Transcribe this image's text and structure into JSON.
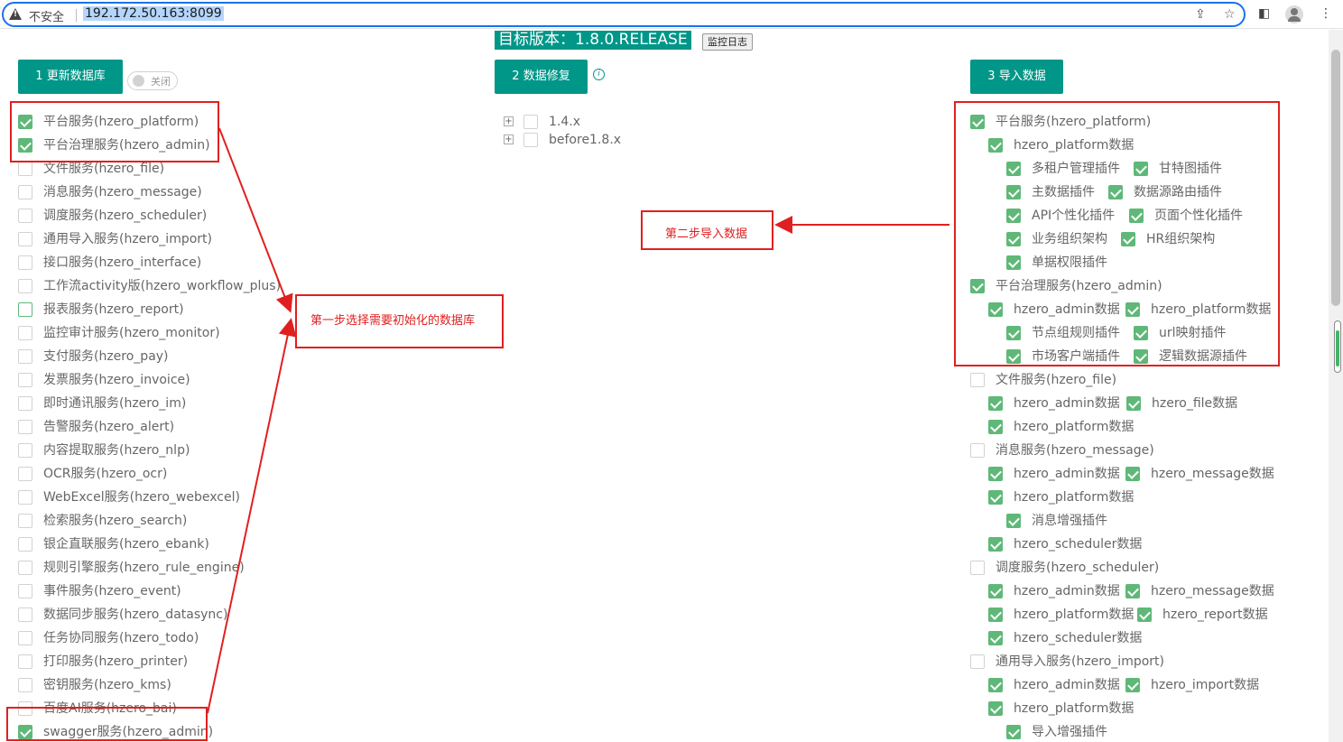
{
  "browser": {
    "insecure_label": "不安全",
    "url": "192.172.50.163:8099",
    "icons": [
      "warning-icon",
      "share-icon",
      "star-icon",
      "sidebar-icon",
      "profile-icon",
      "menu-icon"
    ]
  },
  "header": {
    "target_version": "目标版本：1.8.0.RELEASE",
    "monitor_log_button": "监控日志"
  },
  "steps": {
    "step1": "1 更新数据库",
    "toggle": "关闭",
    "step2": "2 数据修复",
    "step3": "3 导入数据"
  },
  "left_services": [
    {
      "label": "平台服务(hzero_platform)",
      "checked": true
    },
    {
      "label": "平台治理服务(hzero_admin)",
      "checked": true
    },
    {
      "label": "文件服务(hzero_file)",
      "checked": false
    },
    {
      "label": "消息服务(hzero_message)",
      "checked": false
    },
    {
      "label": "调度服务(hzero_scheduler)",
      "checked": false
    },
    {
      "label": "通用导入服务(hzero_import)",
      "checked": false
    },
    {
      "label": "接口服务(hzero_interface)",
      "checked": false
    },
    {
      "label": "工作流activity版(hzero_workflow_plus)",
      "checked": false
    },
    {
      "label": "报表服务(hzero_report)",
      "checked": false
    },
    {
      "label": "监控审计服务(hzero_monitor)",
      "checked": false
    },
    {
      "label": "支付服务(hzero_pay)",
      "checked": false
    },
    {
      "label": "发票服务(hzero_invoice)",
      "checked": false
    },
    {
      "label": "即时通讯服务(hzero_im)",
      "checked": false
    },
    {
      "label": "告警服务(hzero_alert)",
      "checked": false
    },
    {
      "label": "内容提取服务(hzero_nlp)",
      "checked": false
    },
    {
      "label": "OCR服务(hzero_ocr)",
      "checked": false
    },
    {
      "label": "WebExcel服务(hzero_webexcel)",
      "checked": false
    },
    {
      "label": "检索服务(hzero_search)",
      "checked": false
    },
    {
      "label": "银企直联服务(hzero_ebank)",
      "checked": false
    },
    {
      "label": "规则引擎服务(hzero_rule_engine)",
      "checked": false
    },
    {
      "label": "事件服务(hzero_event)",
      "checked": false
    },
    {
      "label": "数据同步服务(hzero_datasync)",
      "checked": false
    },
    {
      "label": "任务协同服务(hzero_todo)",
      "checked": false
    },
    {
      "label": "打印服务(hzero_printer)",
      "checked": false
    },
    {
      "label": "密钥服务(hzero_kms)",
      "checked": false
    },
    {
      "label": "百度AI服务(hzero_bai)",
      "checked": false
    },
    {
      "label": "swagger服务(hzero_admin)",
      "checked": true
    }
  ],
  "repair_versions": [
    "1.4.x",
    "before1.8.x"
  ],
  "import_rows": [
    [
      {
        "label": "平台服务(hzero_platform)",
        "checked": true,
        "level": 0
      }
    ],
    [
      {
        "label": "hzero_platform数据",
        "checked": true,
        "level": 1
      }
    ],
    [
      {
        "label": "多租户管理插件",
        "checked": true,
        "level": 2
      },
      {
        "label": "甘特图插件",
        "checked": true
      }
    ],
    [
      {
        "label": "主数据插件",
        "checked": true,
        "level": 2
      },
      {
        "label": "数据源路由插件",
        "checked": true
      }
    ],
    [
      {
        "label": "API个性化插件",
        "checked": true,
        "level": 2
      },
      {
        "label": "页面个性化插件",
        "checked": true
      }
    ],
    [
      {
        "label": "业务组织架构",
        "checked": true,
        "level": 2
      },
      {
        "label": "HR组织架构",
        "checked": true
      }
    ],
    [
      {
        "label": "单据权限插件",
        "checked": true,
        "level": 2
      }
    ],
    [
      {
        "label": "平台治理服务(hzero_admin)",
        "checked": true,
        "level": 0
      }
    ],
    [
      {
        "label": "hzero_admin数据",
        "checked": true,
        "level": 1
      },
      {
        "label": "hzero_platform数据",
        "checked": true
      }
    ],
    [
      {
        "label": "节点组规则插件",
        "checked": true,
        "level": 2
      },
      {
        "label": "url映射插件",
        "checked": true
      }
    ],
    [
      {
        "label": "市场客户端插件",
        "checked": true,
        "level": 2
      },
      {
        "label": "逻辑数据源插件",
        "checked": true
      }
    ],
    [
      {
        "label": "文件服务(hzero_file)",
        "checked": false,
        "level": 0
      }
    ],
    [
      {
        "label": "hzero_admin数据",
        "checked": true,
        "level": 1
      },
      {
        "label": "hzero_file数据",
        "checked": true
      }
    ],
    [
      {
        "label": "hzero_platform数据",
        "checked": true,
        "level": 1
      }
    ],
    [
      {
        "label": "消息服务(hzero_message)",
        "checked": false,
        "level": 0
      }
    ],
    [
      {
        "label": "hzero_admin数据",
        "checked": true,
        "level": 1
      },
      {
        "label": "hzero_message数据",
        "checked": true
      }
    ],
    [
      {
        "label": "hzero_platform数据",
        "checked": true,
        "level": 1
      }
    ],
    [
      {
        "label": "消息增强插件",
        "checked": true,
        "level": 2
      }
    ],
    [
      {
        "label": "hzero_scheduler数据",
        "checked": true,
        "level": 1
      }
    ],
    [
      {
        "label": "调度服务(hzero_scheduler)",
        "checked": false,
        "level": 0
      }
    ],
    [
      {
        "label": "hzero_admin数据",
        "checked": true,
        "level": 1
      },
      {
        "label": "hzero_message数据",
        "checked": true
      }
    ],
    [
      {
        "label": "hzero_platform数据",
        "checked": true,
        "level": 1
      },
      {
        "label": "hzero_report数据",
        "checked": true
      }
    ],
    [
      {
        "label": "hzero_scheduler数据",
        "checked": true,
        "level": 1
      }
    ],
    [
      {
        "label": "通用导入服务(hzero_import)",
        "checked": false,
        "level": 0
      }
    ],
    [
      {
        "label": "hzero_admin数据",
        "checked": true,
        "level": 1
      },
      {
        "label": "hzero_import数据",
        "checked": true
      }
    ],
    [
      {
        "label": "hzero_platform数据",
        "checked": true,
        "level": 1
      }
    ],
    [
      {
        "label": "导入增强插件",
        "checked": true,
        "level": 2
      }
    ]
  ],
  "annotations": {
    "step1_note": "第一步选择需要初始化的数据库",
    "step2_note": "第二步导入数据",
    "color": "#e02020"
  },
  "colors": {
    "primary": "#009688",
    "checked": "#5fb878"
  }
}
